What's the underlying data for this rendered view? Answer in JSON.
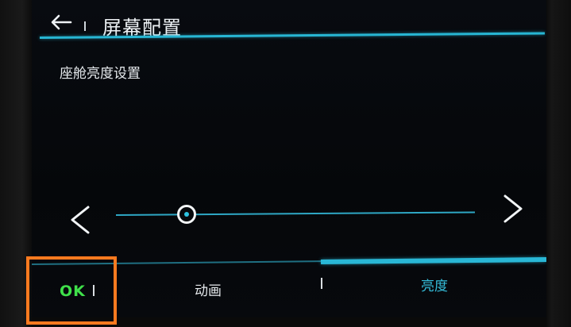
{
  "header": {
    "back_icon": "arrow-left-icon",
    "title": "屏幕配置"
  },
  "section": {
    "label": "座舱亮度设置"
  },
  "slider": {
    "prev_icon": "chevron-left-icon",
    "next_icon": "chevron-right-icon",
    "level_fraction": 0.21
  },
  "tabbar": {
    "ok_label": "OK",
    "tabs": [
      {
        "label": "动画",
        "active": false
      },
      {
        "label": "亮度",
        "active": true
      }
    ]
  },
  "colors": {
    "accent": "#29b7d6",
    "ok_green": "#3fe04a",
    "highlight_orange": "#ff7a1f"
  }
}
